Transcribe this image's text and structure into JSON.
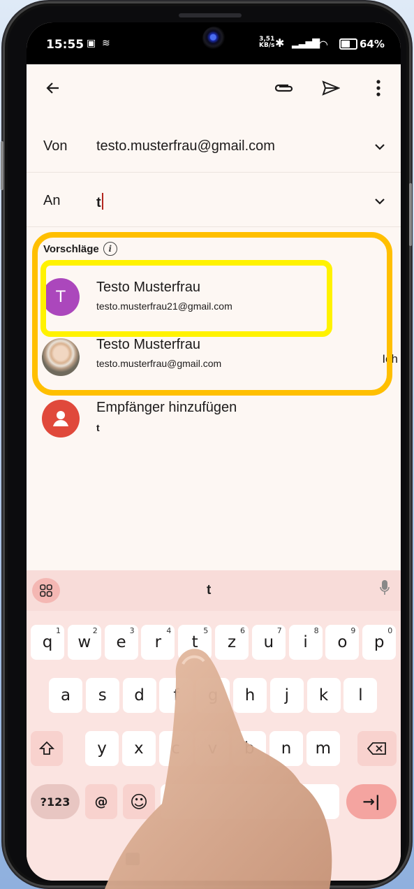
{
  "status_bar": {
    "time": "15:55",
    "net_speed_value": "3,51",
    "net_speed_unit": "KB/s",
    "battery": "64%"
  },
  "app_bar": {
    "back_icon": "arrow-left-icon",
    "attach_icon": "paperclip-icon",
    "send_icon": "send-icon",
    "more_icon": "more-vert-icon"
  },
  "from": {
    "label": "Von",
    "value": "testo.musterfrau@gmail.com"
  },
  "to": {
    "label": "An",
    "value": "t"
  },
  "suggestions": {
    "heading": "Vorschläge",
    "items": [
      {
        "initial": "T",
        "name": "Testo Musterfrau",
        "email": "testo.musterfrau21@gmail.com",
        "tag": "",
        "avatar_color": "#ab47bc"
      },
      {
        "initial": "",
        "name": "Testo Musterfrau",
        "email": "testo.musterfrau@gmail.com",
        "tag": "Ich",
        "avatar_color": "#c9a88c"
      }
    ]
  },
  "add_recipient": {
    "label": "Empfänger hinzufügen",
    "value": "t",
    "avatar_color": "#e0493b"
  },
  "keyboard": {
    "suggestion": "t",
    "row1": [
      {
        "k": "q",
        "n": "1"
      },
      {
        "k": "w",
        "n": "2"
      },
      {
        "k": "e",
        "n": "3"
      },
      {
        "k": "r",
        "n": "4"
      },
      {
        "k": "t",
        "n": "5"
      },
      {
        "k": "z",
        "n": "6"
      },
      {
        "k": "u",
        "n": "7"
      },
      {
        "k": "i",
        "n": "8"
      },
      {
        "k": "o",
        "n": "9"
      },
      {
        "k": "p",
        "n": "0"
      }
    ],
    "row2": [
      "a",
      "s",
      "d",
      "f",
      "g",
      "h",
      "j",
      "k",
      "l"
    ],
    "row3": [
      "y",
      "x",
      "c",
      "v",
      "b",
      "n",
      "m"
    ],
    "symbols_label": "?123",
    "at_label": "@",
    "emoji_label": "☺",
    "enter_label": "→|"
  },
  "colors": {
    "highlight_outer": "#ffbf00",
    "highlight_inner": "#fff200",
    "keyboard_bg": "#fbe4e1",
    "enter_key": "#f4a4a0"
  }
}
